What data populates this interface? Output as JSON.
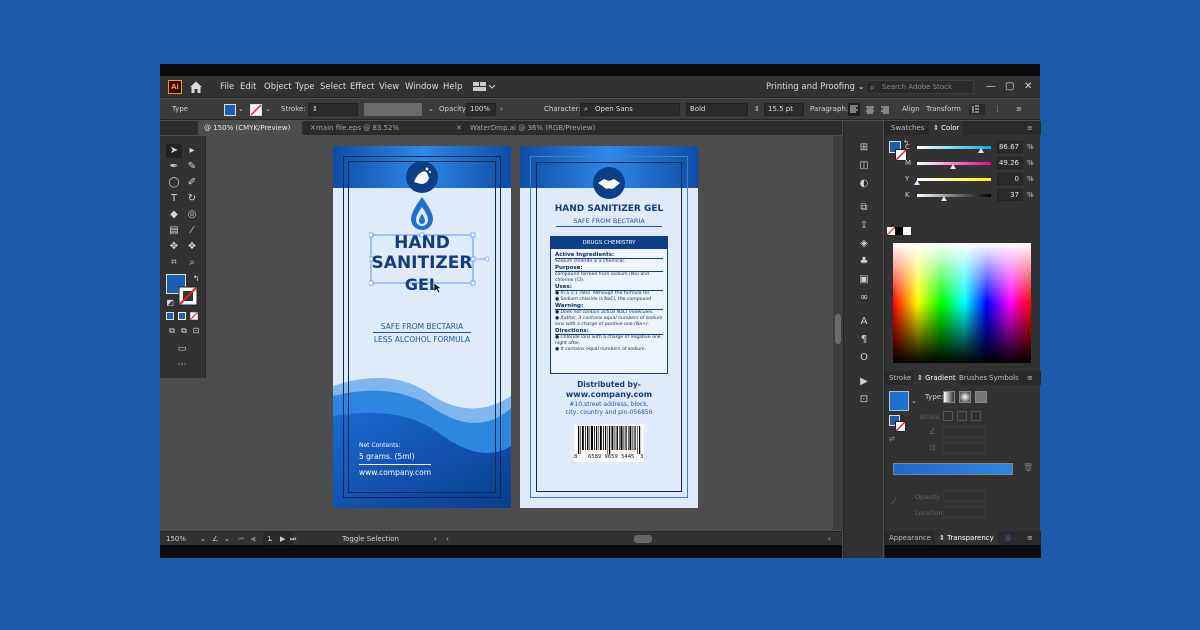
{
  "menubar": {
    "app_icon": "Ai",
    "items": [
      "File",
      "Edit",
      "Object",
      "Type",
      "Select",
      "Effect",
      "View",
      "Window",
      "Help"
    ],
    "workspace": "Printing and Proofing",
    "search_placeholder": "Search Adobe Stock"
  },
  "control_bar": {
    "selection_type": "Type",
    "stroke_label": "Stroke:",
    "opacity_label": "Opacity:",
    "opacity_value": "100%",
    "character_label": "Character:",
    "font_family": "Open Sans",
    "font_style": "Bold",
    "font_size": "15.5 pt",
    "paragraph_label": "Paragraph:",
    "align_label": "Align",
    "transform_label": "Transform",
    "fill_color": "#1a5fb4"
  },
  "tabs": [
    {
      "label": "@ 150% (CMYK/Preview)",
      "active": true
    },
    {
      "label": "main file.eps @ 83.52% (RGB/Preview)",
      "active": false
    },
    {
      "label": "WaterDrop.ai @ 36% (RGB/Preview)",
      "active": false
    }
  ],
  "status_bar": {
    "zoom": "150%",
    "artboard": "1",
    "tool_hint": "Toggle Selection"
  },
  "panel": {
    "tabs_top": [
      "Swatches",
      "Color"
    ],
    "active_top": "Color",
    "cmyk": [
      {
        "channel": "C",
        "value": "86.67",
        "unit": "%",
        "level": 0.8667
      },
      {
        "channel": "M",
        "value": "49.26",
        "unit": "%",
        "level": 0.4926
      },
      {
        "channel": "Y",
        "value": "0",
        "unit": "%",
        "level": 0.0
      },
      {
        "channel": "K",
        "value": "37",
        "unit": "%",
        "level": 0.37
      }
    ],
    "tabs_mid": [
      "Stroke",
      "Gradient",
      "Brushes",
      "Symbols"
    ],
    "active_mid": "Gradient",
    "type_label": "Type:",
    "stroke_label": "Stroke",
    "opacity_label": "Opacity",
    "location_label": "Location",
    "tabs_bottom": [
      "Appearance",
      "Transparency"
    ],
    "active_bottom": "Transparency"
  },
  "front_label": {
    "title_line1": "HAND",
    "title_line2": "SANITIZER",
    "title_line3": "GEL",
    "subtitle1": "SAFE FROM BECTARIA",
    "subtitle2": "LESS ALCOHOL FORMULA",
    "net_contents_label": "Net Contents:",
    "net_contents_value": "5 grams. (5ml)",
    "website": "www.company.com"
  },
  "back_label": {
    "title": "HAND SANITIZER GEL",
    "subtitle": "SAFE FROM BECTARIA",
    "box_header": "DRUGS CHEMISTRY",
    "active_heading": "Active Ingredients:",
    "active_text": "Sodium chloride is a chemical.",
    "purpose_heading": "Purpose:",
    "purpose_text": "compound formed from sodium (Na) and chlorine (Cl).",
    "uses_heading": "Uses:",
    "uses_items": [
      "In a 1:1 ratio. Although the formula for",
      "Sodium chloride is NaCl, the compound"
    ],
    "warning_heading": "Warning:",
    "warning_items": [
      "Does not contain actual NaCl molecules.",
      "Rather, it contains equal numbers of sodium",
      "ions with a charge of positive one (Na+)."
    ],
    "directions_heading": "Directions:",
    "directions_items": [
      "Chloride ions with a charge of negative one",
      "night after.",
      "It contains equal numbers of sodium."
    ],
    "distributed_by": "Distributed by-",
    "distributor_web": "www.company.com",
    "address_line1": "#10,street   address,   block,",
    "address_line2": "city, country and pin-056856",
    "barcode_digits": [
      "8",
      "6589 9659 5445",
      "3"
    ]
  },
  "colors": {
    "label_blue": "#1d6fd0",
    "label_dark": "#0a2a5c",
    "label_bg": "#dfeafa",
    "ui_bg": "#4d4d4d",
    "panel_bg": "#323232"
  }
}
